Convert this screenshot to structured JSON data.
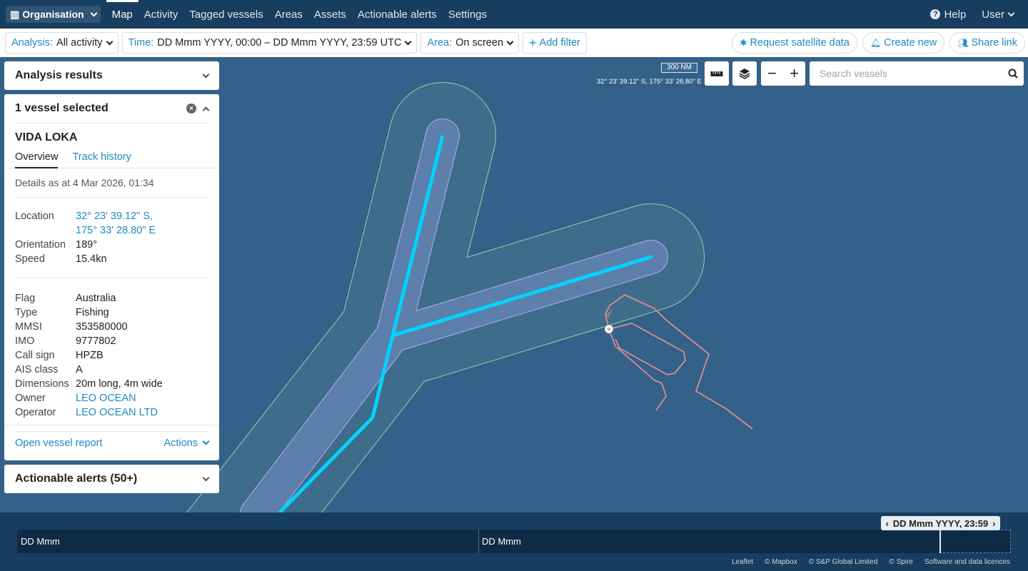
{
  "nav": {
    "org_label": "Organisation",
    "links": [
      "Map",
      "Activity",
      "Tagged vessels",
      "Areas",
      "Assets",
      "Actionable alerts",
      "Settings"
    ],
    "help_label": "Help",
    "user_label": "User"
  },
  "filters": {
    "analysis_label": "Analysis:",
    "analysis_value": "All activity",
    "time_label": "Time:",
    "time_value": "DD Mmm YYYY, 00:00 – DD Mmm YYYY, 23:59 UTC",
    "area_label": "Area:",
    "area_value": "On screen",
    "add_filter_label": "Add filter",
    "request_satellite_label": "Request satellite data",
    "create_new_label": "Create new",
    "share_link_label": "Share link"
  },
  "map": {
    "scale_label": "300 NM",
    "cursor_coords": "32° 23' 39.12\" S, 175° 33' 28.80\" E",
    "search_placeholder": "Search vessels",
    "zoom_out_label": "−",
    "zoom_in_label": "+"
  },
  "panels": {
    "analysis_results_title": "Analysis results",
    "vessel_selected_title": "1 vessel selected",
    "actionable_alerts_title": "Actionable alerts (50+)"
  },
  "vessel": {
    "name": "VIDA LOKA",
    "tabs": [
      "Overview",
      "Track history"
    ],
    "details_as_at": "Details as at 4 Mar 2026, 01:34",
    "group1": [
      {
        "k": "Location",
        "v": "32° 23' 39.12\" S,",
        "v2": "175° 33' 28.80\" E"
      },
      {
        "k": "Orientation",
        "v": "189°"
      },
      {
        "k": "Speed",
        "v": "15.4kn"
      }
    ],
    "group2": [
      {
        "k": "Flag",
        "v": "Australia"
      },
      {
        "k": "Type",
        "v": "Fishing"
      },
      {
        "k": "MMSI",
        "v": "353580000"
      },
      {
        "k": "IMO",
        "v": "9777802"
      },
      {
        "k": "Call sign",
        "v": "HPZB"
      },
      {
        "k": "AIS class",
        "v": "A"
      },
      {
        "k": "Dimensions",
        "v": "20m long, 4m wide"
      },
      {
        "k": "Owner",
        "v": "LEO OCEAN"
      },
      {
        "k": "Operator",
        "v": "LEO OCEAN LTD"
      }
    ],
    "open_report_label": "Open vessel report",
    "actions_label": "Actions"
  },
  "timeline": {
    "label_left": "DD Mmm",
    "label_mid": "DD Mmm",
    "handle_label": "DD Mmm YYYY, 23:59"
  },
  "attribution": [
    "Leaflet",
    "© Mapbox",
    "© S&P Global Limited",
    "© Spire",
    "Software and data licences"
  ],
  "colors": {
    "nav_bg": "#173e5f",
    "map_sea": "#346189",
    "link_blue": "#1f8ac0",
    "route_line": "#00d4ff",
    "track_line": "#d98e8e"
  }
}
